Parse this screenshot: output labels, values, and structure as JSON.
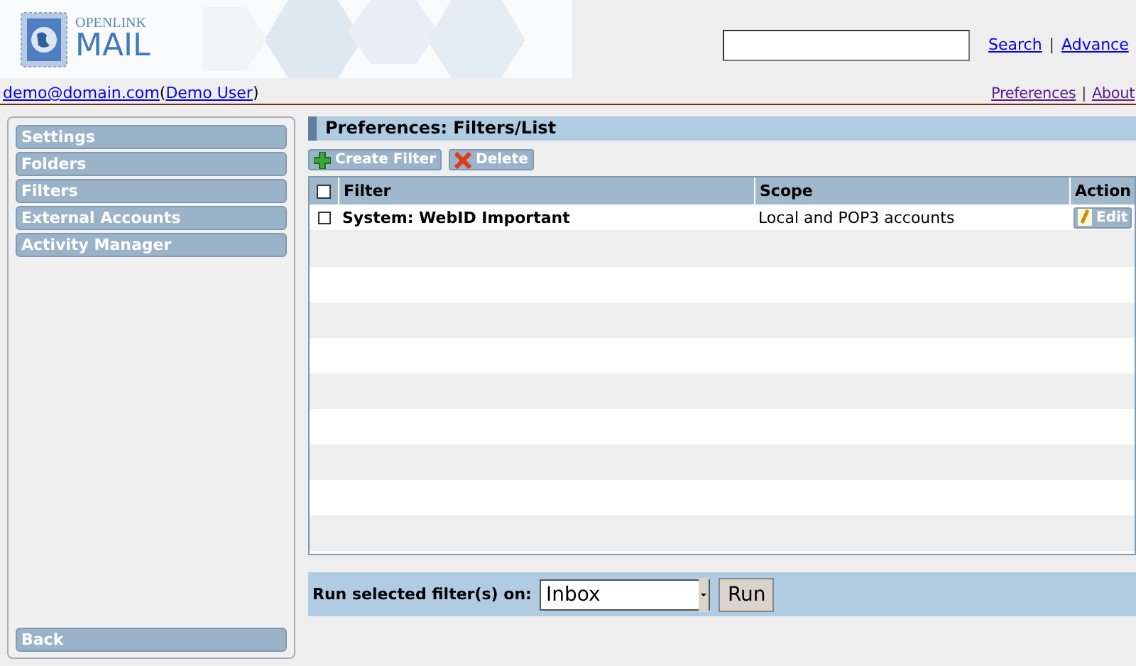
{
  "header": {
    "logo_small": "OPENLINK",
    "logo_large": "MAIL",
    "search_links": [
      "Search",
      "Advance"
    ],
    "search_separator": "|",
    "user_email": "demo@domain.com",
    "paren_open": "(",
    "user_name": "Demo User",
    "paren_close": ")",
    "top_links": [
      "Preferences",
      "About"
    ],
    "top_separator": "|"
  },
  "sidebar": {
    "items": [
      "Settings",
      "Folders",
      "Filters",
      "External Accounts",
      "Activity Manager"
    ],
    "back": "Back"
  },
  "main": {
    "title": "Preferences: Filters/List",
    "toolbar": [
      {
        "kind": "create",
        "label": "Create Filter"
      },
      {
        "kind": "delete",
        "label": "Delete"
      }
    ],
    "table": {
      "columns": [
        "Filter",
        "Scope",
        "Action"
      ],
      "select_all_checked": false,
      "rows": [
        {
          "checked": false,
          "filter": "System: WebID Important",
          "scope": "Local and POP3 accounts",
          "action": "Edit"
        }
      ]
    },
    "run_bar": {
      "label": "Run selected filter(s) on:",
      "folder": "Inbox",
      "button": "Run"
    }
  }
}
